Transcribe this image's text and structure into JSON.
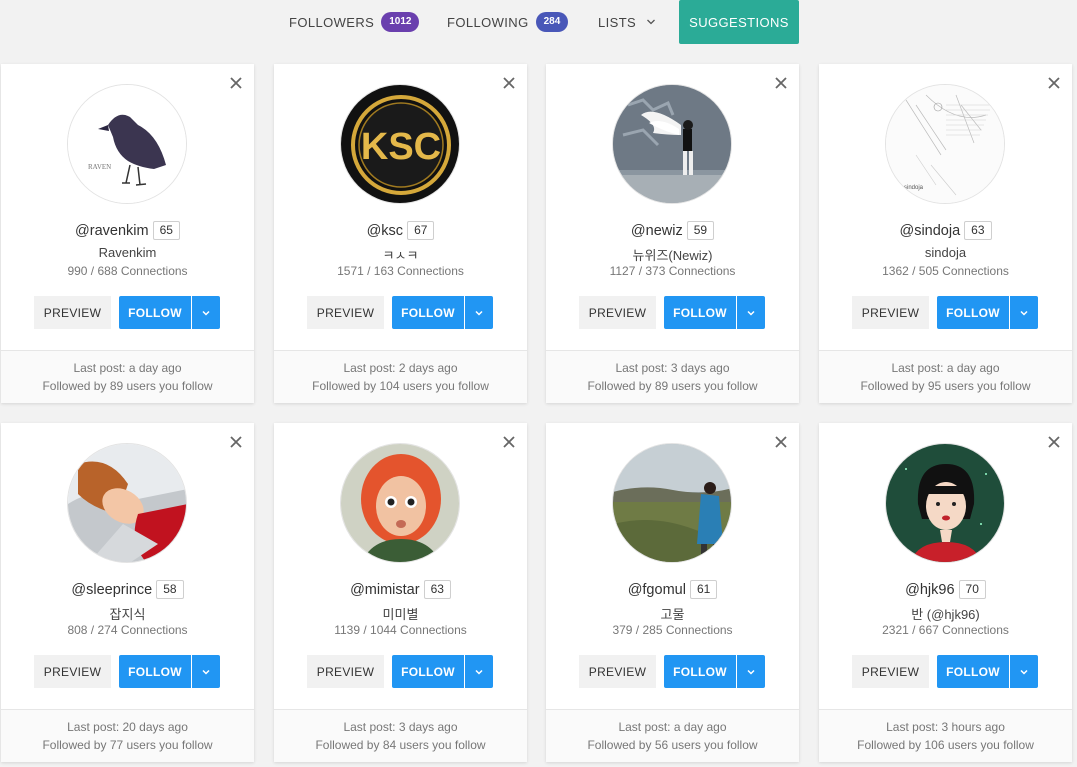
{
  "nav": {
    "followers": {
      "label": "FOLLOWERS",
      "count": "1012"
    },
    "following": {
      "label": "FOLLOWING",
      "count": "284"
    },
    "lists": {
      "label": "LISTS"
    },
    "suggestions": {
      "label": "SUGGESTIONS"
    }
  },
  "colors": {
    "followers_badge": "#6a3fae",
    "following_badge": "#4957b8",
    "suggestions_active": "#2bab97",
    "follow_button": "#2196f3"
  },
  "buttons": {
    "preview": "PREVIEW",
    "follow": "FOLLOW"
  },
  "cards": [
    {
      "handle": "@ravenkim",
      "score": "65",
      "name": "Ravenkim",
      "connections": "990 / 688 Connections",
      "last_post": "Last post: a day ago",
      "followed_by": "Followed by 89 users you follow",
      "avatar": "crow-drawing",
      "avatar_text": "RAVEN"
    },
    {
      "handle": "@ksc",
      "score": "67",
      "name": "ㅋㅅㅋ",
      "connections": "1571 / 163 Connections",
      "last_post": "Last post: 2 days ago",
      "followed_by": "Followed by 104 users you follow",
      "avatar": "ksc-gold-logo",
      "avatar_text": "KSC"
    },
    {
      "handle": "@newiz",
      "score": "59",
      "name": "뉴위즈(Newiz)",
      "connections": "1127 / 373 Connections",
      "last_post": "Last post: 3 days ago",
      "followed_by": "Followed by 89 users you follow",
      "avatar": "angel-wings-photo"
    },
    {
      "handle": "@sindoja",
      "score": "63",
      "name": "sindoja",
      "connections": "1362 / 505 Connections",
      "last_post": "Last post: a day ago",
      "followed_by": "Followed by 95 users you follow",
      "avatar": "sketch-lines",
      "avatar_text": "sindoja"
    },
    {
      "handle": "@sleeprince",
      "score": "58",
      "name": "잡지식",
      "connections": "808 / 274 Connections",
      "last_post": "Last post: 20 days ago",
      "followed_by": "Followed by 77 users you follow",
      "avatar": "sleeping-prince-cartoon"
    },
    {
      "handle": "@mimistar",
      "score": "63",
      "name": "미미별",
      "connections": "1139 / 1044 Connections",
      "last_post": "Last post: 3 days ago",
      "followed_by": "Followed by 84 users you follow",
      "avatar": "red-hair-girl-3d"
    },
    {
      "handle": "@fgomul",
      "score": "61",
      "name": "고물",
      "connections": "379 / 285 Connections",
      "last_post": "Last post: a day ago",
      "followed_by": "Followed by 56 users you follow",
      "avatar": "hiker-landscape-photo"
    },
    {
      "handle": "@hjk96",
      "score": "70",
      "name": "반 (@hjk96)",
      "connections": "2321 / 667 Connections",
      "last_post": "Last post: 3 hours ago",
      "followed_by": "Followed by 106 users you follow",
      "avatar": "bob-hair-girl-illustration"
    }
  ]
}
